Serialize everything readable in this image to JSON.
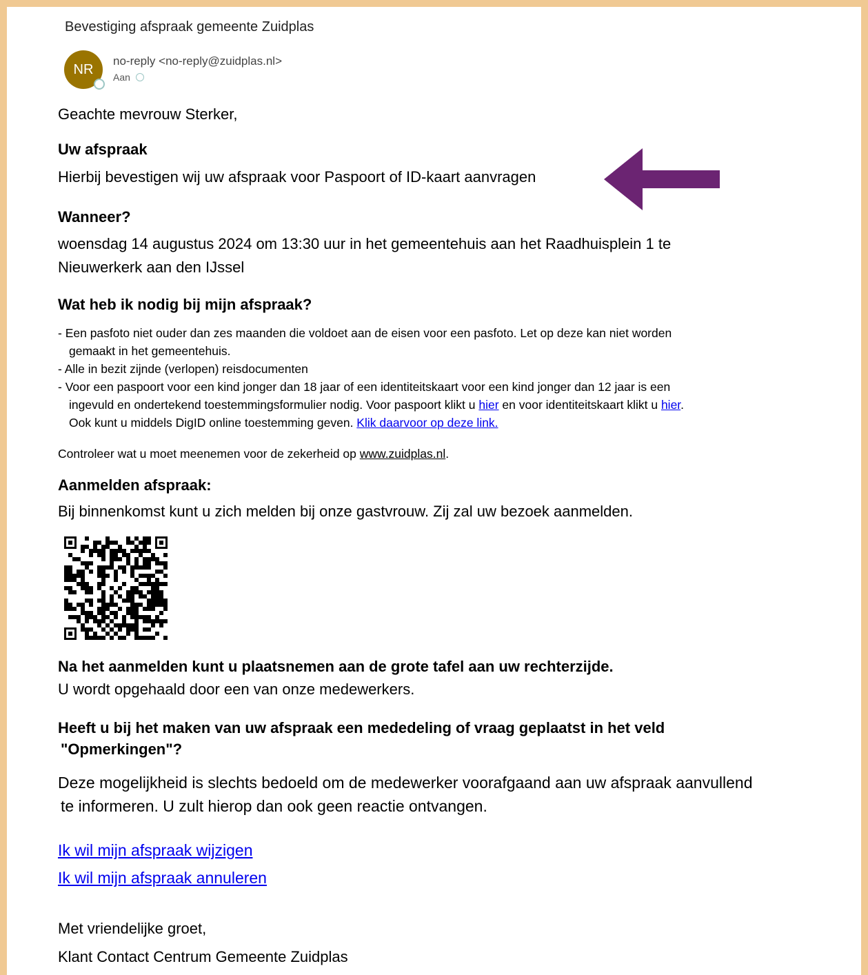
{
  "email": {
    "subject": "Bevestiging afspraak gemeente Zuidplas",
    "avatar_initials": "NR",
    "sender": "no-reply <no-reply@zuidplas.nl>",
    "to_label": "Aan"
  },
  "body": {
    "greeting": "Geachte mevrouw Sterker,",
    "section_appointment_heading": "Uw afspraak",
    "section_appointment_text": "Hierbij bevestigen wij uw afspraak voor Paspoort of ID-kaart aanvragen",
    "section_when_heading": "Wanneer?",
    "section_when_line1": "woensdag 14 augustus 2024 om 13:30 uur in het gemeentehuis aan het Raadhuisplein 1 te",
    "section_when_line2": "Nieuwerkerk aan den IJssel",
    "section_need_heading": "Wat heb ik nodig bij mijn afspraak?",
    "bullet1_line1": "- Een pasfoto niet ouder dan zes maanden die voldoet aan de eisen voor een pasfoto. Let op deze kan niet worden",
    "bullet1_line2": "gemaakt in het gemeentehuis.",
    "bullet2": "- Alle in bezit zijnde (verlopen) reisdocumenten",
    "bullet3_line1": "- Voor een paspoort voor een kind jonger dan 18 jaar of een identiteitskaart voor een kind jonger dan 12 jaar is een",
    "bullet3_line2_a": "ingevuld en ondertekend toestemmingsformulier nodig. Voor paspoort klikt u ",
    "bullet3_link_passport": "hier",
    "bullet3_line2_b": " en voor identiteitskaart klikt u ",
    "bullet3_link_id": "hier",
    "bullet3_line2_c": ".",
    "bullet3_line3_a": "Ook kunt u middels DigID online toestemming geven. ",
    "bullet3_link_digid": "Klik daarvoor op deze link.",
    "check_text_a": "Controleer wat u moet meenemen voor de zekerheid op ",
    "check_link": "www.zuidplas.nl",
    "check_text_b": ".",
    "register_heading": "Aanmelden afspraak:",
    "register_text": "Bij binnenkomst kunt u zich melden bij onze gastvrouw. Zij zal uw bezoek aanmelden.",
    "after_heading": "Na het aanmelden kunt u plaatsnemen aan de grote tafel aan uw rechterzijde.",
    "after_text": "U wordt opgehaald door een van onze medewerkers.",
    "remarks_heading_line1": "Heeft u bij het maken van uw afspraak een mededeling of vraag geplaatst in het veld",
    "remarks_heading_line2": "\"Opmerkingen\"?",
    "remarks_text_line1": "Deze mogelijkheid is slechts bedoeld om de medewerker voorafgaand aan uw afspraak aanvullend",
    "remarks_text_line2": "te informeren. U zult hierop dan ook geen reactie ontvangen.",
    "link_change": "Ik wil mijn afspraak wijzigen",
    "link_cancel": "Ik wil mijn afspraak annuleren",
    "closing": "Met vriendelijke groet,",
    "signature": "Klant Contact Centrum Gemeente Zuidplas"
  },
  "colors": {
    "frame": "#f0c993",
    "arrow": "#6b2472",
    "avatar": "#9a7400",
    "link": "#0000ee"
  },
  "icons": {
    "arrow": "left-arrow-icon",
    "qr": "qr-code-icon"
  }
}
